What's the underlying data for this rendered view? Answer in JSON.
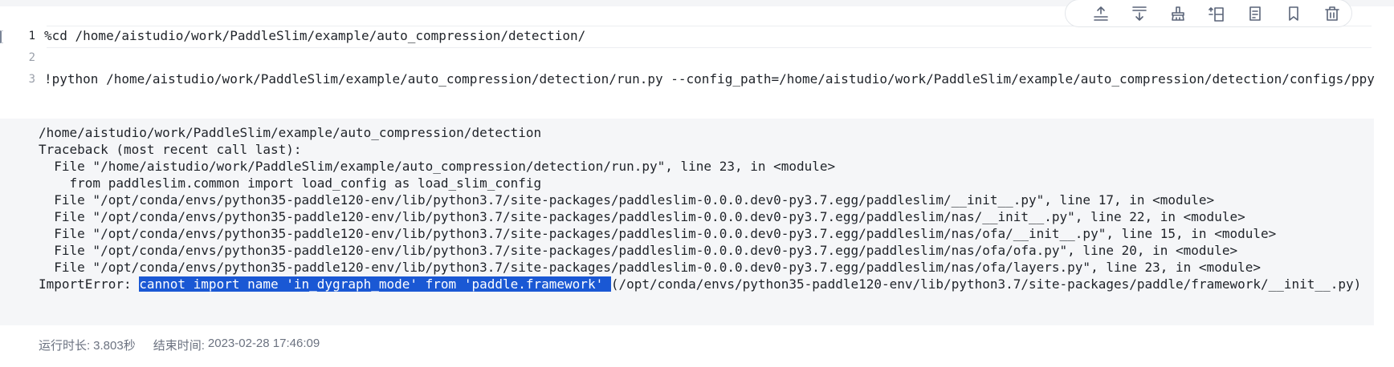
{
  "editor": {
    "lines": [
      {
        "num": "1",
        "code": "%cd /home/aistudio/work/PaddleSlim/example/auto_compression/detection/"
      },
      {
        "num": "2",
        "code": ""
      },
      {
        "num": "3",
        "code": "!python /home/aistudio/work/PaddleSlim/example/auto_compression/detection/run.py --config_path=/home/aistudio/work/PaddleSlim/example/auto_compression/detection/configs/ppy"
      }
    ]
  },
  "toolbar": {
    "buttons": [
      {
        "icon": "insert-above-icon"
      },
      {
        "icon": "insert-below-icon"
      },
      {
        "icon": "clear-output-icon"
      },
      {
        "icon": "split-cell-icon"
      },
      {
        "icon": "convert-to-markdown-icon"
      },
      {
        "icon": "bookmark-icon"
      },
      {
        "icon": "delete-icon"
      }
    ]
  },
  "output": {
    "lines": [
      "/home/aistudio/work/PaddleSlim/example/auto_compression/detection",
      "Traceback (most recent call last):",
      "  File \"/home/aistudio/work/PaddleSlim/example/auto_compression/detection/run.py\", line 23, in <module>",
      "    from paddleslim.common import load_config as load_slim_config",
      "  File \"/opt/conda/envs/python35-paddle120-env/lib/python3.7/site-packages/paddleslim-0.0.0.dev0-py3.7.egg/paddleslim/__init__.py\", line 17, in <module>",
      "  File \"/opt/conda/envs/python35-paddle120-env/lib/python3.7/site-packages/paddleslim-0.0.0.dev0-py3.7.egg/paddleslim/nas/__init__.py\", line 22, in <module>",
      "  File \"/opt/conda/envs/python35-paddle120-env/lib/python3.7/site-packages/paddleslim-0.0.0.dev0-py3.7.egg/paddleslim/nas/ofa/__init__.py\", line 15, in <module>",
      "  File \"/opt/conda/envs/python35-paddle120-env/lib/python3.7/site-packages/paddleslim-0.0.0.dev0-py3.7.egg/paddleslim/nas/ofa/ofa.py\", line 20, in <module>",
      "  File \"/opt/conda/envs/python35-paddle120-env/lib/python3.7/site-packages/paddleslim-0.0.0.dev0-py3.7.egg/paddleslim/nas/ofa/layers.py\", line 23, in <module>"
    ],
    "error_prefix": "ImportError: ",
    "error_highlight": "cannot import name 'in_dygraph_mode' from 'paddle.framework' ",
    "error_suffix": "(/opt/conda/envs/python35-paddle120-env/lib/python3.7/site-packages/paddle/framework/__init__.py)"
  },
  "status": {
    "runtime_label": "运行时长:",
    "runtime_value": "3.803秒",
    "end_label": "结束时间:",
    "end_value": "2023-02-28 17:46:09"
  },
  "colors": {
    "highlight": "#1a58d4",
    "output_bg": "#f5f6f8"
  }
}
